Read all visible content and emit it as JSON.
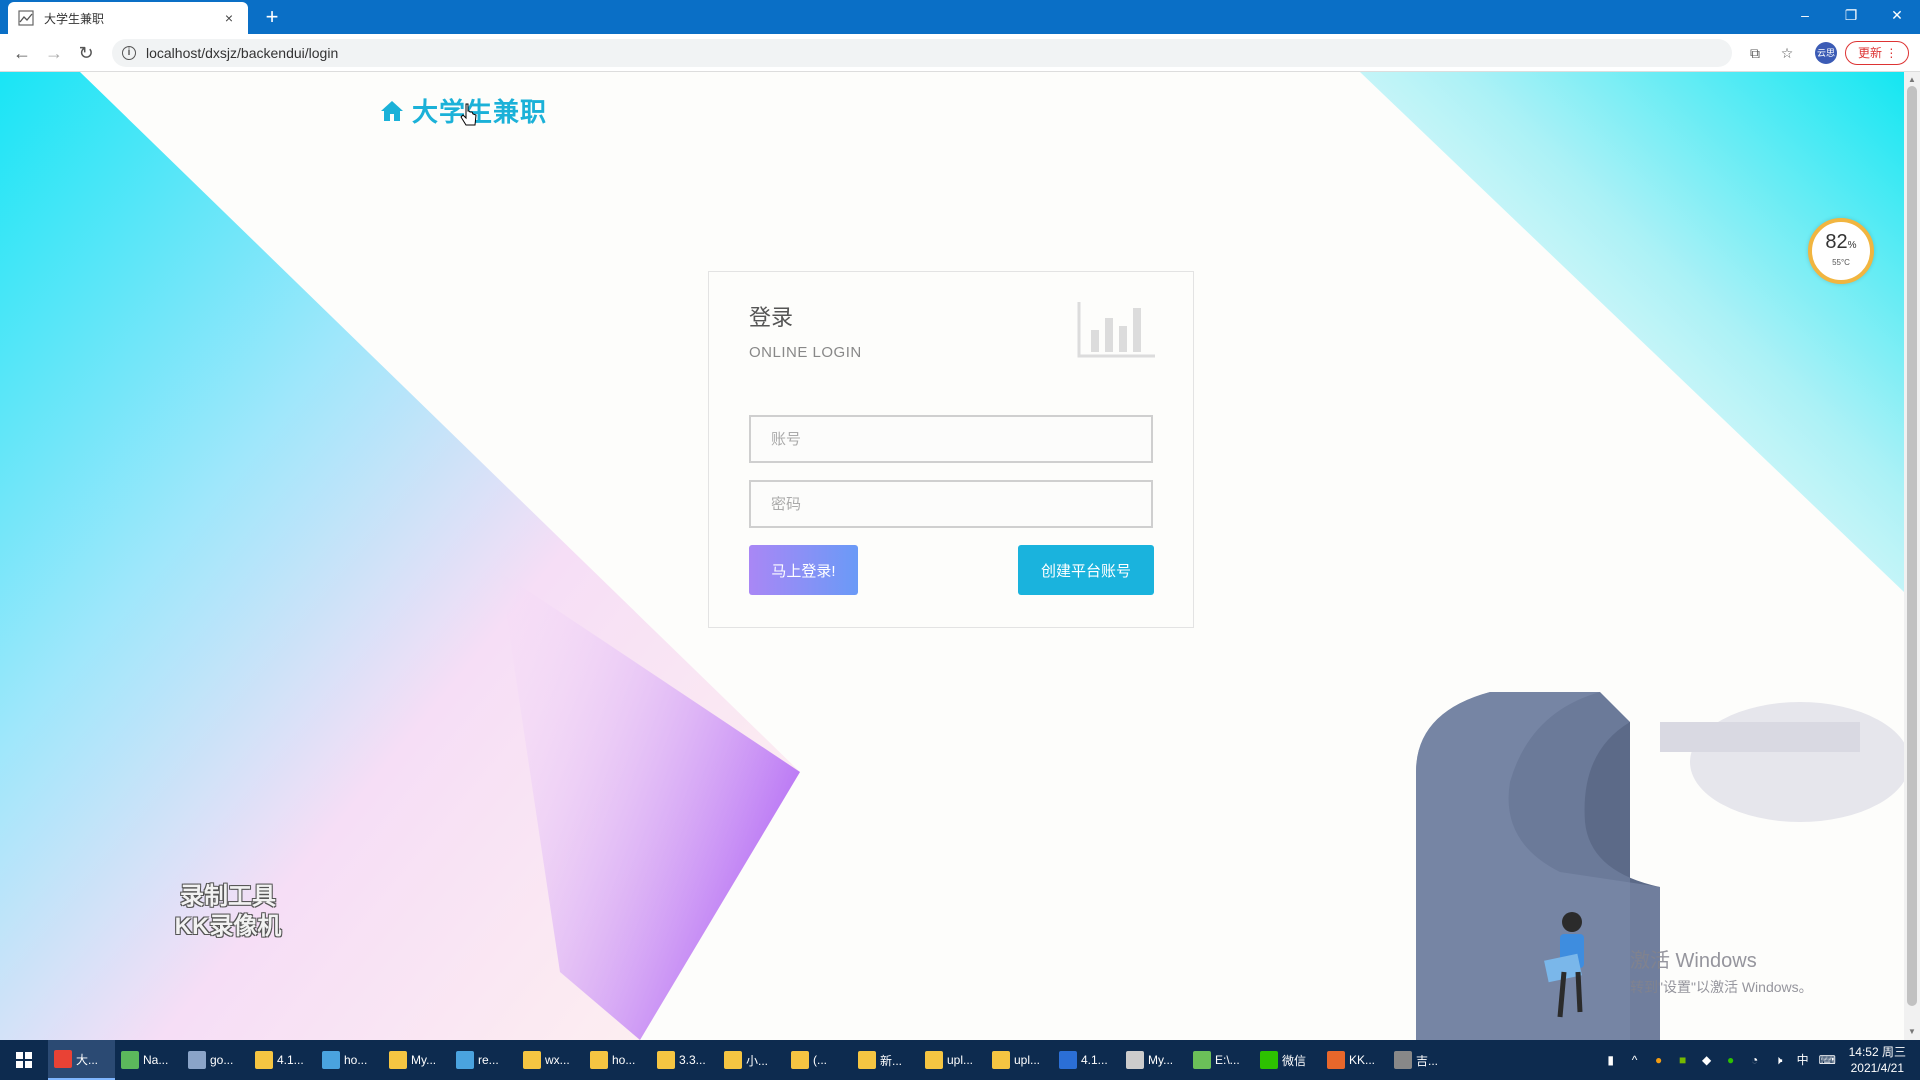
{
  "browser": {
    "tab_title": "大学生兼职",
    "tab_close": "×",
    "new_tab": "+",
    "url": "localhost/dxsjz/backendui/login",
    "profile_label": "云思",
    "update_label": "更新",
    "window_controls": {
      "minimize": "–",
      "restore": "❐",
      "close": "✕"
    }
  },
  "page": {
    "brand": "大学生兼职",
    "login": {
      "title": "登录",
      "subtitle": "ONLINE LOGIN",
      "account_placeholder": "账号",
      "password_placeholder": "密码",
      "login_button": "马上登录!",
      "register_button": "创建平台账号"
    }
  },
  "overlay": {
    "cpu_percent": "82",
    "cpu_percent_unit": "%",
    "cpu_temp": "55°C",
    "recorder_line1": "录制工具",
    "recorder_line2": "KK录像机",
    "activate_title": "激活 Windows",
    "activate_sub": "转到\"设置\"以激活 Windows。"
  },
  "taskbar": {
    "items": [
      {
        "label": "大...",
        "color": "#e94235",
        "active": true
      },
      {
        "label": "Na...",
        "color": "#5cb85c"
      },
      {
        "label": "go...",
        "color": "#8aa4c8"
      },
      {
        "label": "4.1...",
        "color": "#f5c542"
      },
      {
        "label": "ho...",
        "color": "#4aa3df"
      },
      {
        "label": "My...",
        "color": "#f5c542"
      },
      {
        "label": "re...",
        "color": "#4aa3df"
      },
      {
        "label": "wx...",
        "color": "#f5c542"
      },
      {
        "label": "ho...",
        "color": "#f5c542"
      },
      {
        "label": "3.3...",
        "color": "#f5c542"
      },
      {
        "label": "小...",
        "color": "#f5c542"
      },
      {
        "label": "(...",
        "color": "#f5c542"
      },
      {
        "label": "新...",
        "color": "#f5c542"
      },
      {
        "label": "upl...",
        "color": "#f5c542"
      },
      {
        "label": "upl...",
        "color": "#f5c542"
      },
      {
        "label": "4.1...",
        "color": "#2b6fd6"
      },
      {
        "label": "My...",
        "color": "#cccccc"
      },
      {
        "label": "E:\\...",
        "color": "#6bbf59"
      },
      {
        "label": "微信",
        "color": "#2dc100"
      },
      {
        "label": "KK...",
        "color": "#e8672b"
      },
      {
        "label": "吉...",
        "color": "#888888"
      }
    ],
    "tray_ime": "中",
    "tray_volume": "🕨",
    "clock_time": "14:52 周三",
    "clock_date": "2021/4/21"
  },
  "colors": {
    "accent": "#1bb1d8",
    "tabbar": "#0a6fc6",
    "taskbar": "#0d2b4f",
    "login_gradient_start": "#a987f5",
    "login_gradient_end": "#6a9af7"
  }
}
